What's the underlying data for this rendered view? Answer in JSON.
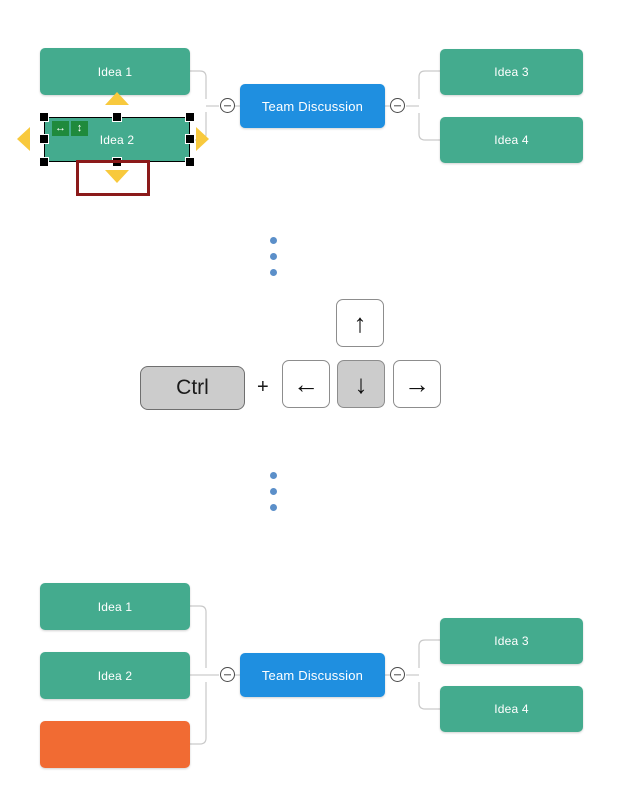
{
  "colors": {
    "node_green": "#44AB8E",
    "node_blue": "#1F8FE0",
    "node_orange": "#F16B33",
    "selection_handle": "#000000",
    "direction_arrow": "#F8C93D",
    "resize_badge": "#1F8A3C",
    "annotation_rect": "#8B1A1A",
    "ellipsis_dot": "#5B8FC9",
    "key_pressed": "#CCCCCC",
    "connector_line": "#C9C9C9"
  },
  "top_diagram": {
    "label": "before-state",
    "center_node": {
      "text": "Team Discussion",
      "color": "blue"
    },
    "left_children": [
      {
        "text": "Idea 1",
        "color": "green",
        "selected": false
      },
      {
        "text": "Idea 2",
        "color": "green",
        "selected": true
      }
    ],
    "right_children": [
      {
        "text": "Idea 3",
        "color": "green"
      },
      {
        "text": "Idea 4",
        "color": "green"
      }
    ],
    "left_toggle": {
      "icon": "minus-circle-icon",
      "state": "expanded"
    },
    "right_toggle": {
      "icon": "minus-circle-icon",
      "state": "expanded"
    }
  },
  "selection": {
    "node_text": "Idea 2",
    "handle_count": 8,
    "badges": [
      {
        "icon": "horizontal-resize-icon",
        "glyph": "↔"
      },
      {
        "icon": "vertical-resize-icon",
        "glyph": "↕"
      }
    ],
    "direction_arrows": [
      {
        "icon": "move-up-arrow-icon",
        "direction": "up"
      },
      {
        "icon": "move-down-arrow-icon",
        "direction": "down",
        "highlighted": true
      },
      {
        "icon": "move-left-arrow-icon",
        "direction": "left"
      },
      {
        "icon": "move-right-arrow-icon",
        "direction": "right"
      }
    ]
  },
  "ellipsis_top": {
    "icon": "vertical-ellipsis-icon",
    "dot_count": 3
  },
  "ellipsis_bottom": {
    "icon": "vertical-ellipsis-icon",
    "dot_count": 3
  },
  "shortcut": {
    "modifier": {
      "label": "Ctrl",
      "pressed": true
    },
    "separator": "+",
    "keys": [
      {
        "name": "arrow-up-key",
        "glyph": "↑",
        "pressed": false
      },
      {
        "name": "arrow-left-key",
        "glyph": "←",
        "pressed": false
      },
      {
        "name": "arrow-down-key",
        "glyph": "↓",
        "pressed": true
      },
      {
        "name": "arrow-right-key",
        "glyph": "→",
        "pressed": false
      }
    ]
  },
  "bottom_diagram": {
    "label": "after-state",
    "center_node": {
      "text": "Team Discussion",
      "color": "blue"
    },
    "left_children": [
      {
        "text": "Idea 1",
        "color": "green"
      },
      {
        "text": "Idea 2",
        "color": "green"
      },
      {
        "text": "",
        "color": "orange"
      }
    ],
    "right_children": [
      {
        "text": "Idea 3",
        "color": "green"
      },
      {
        "text": "Idea 4",
        "color": "green"
      }
    ],
    "left_toggle": {
      "icon": "minus-circle-icon",
      "state": "expanded"
    },
    "right_toggle": {
      "icon": "minus-circle-icon",
      "state": "expanded"
    }
  }
}
